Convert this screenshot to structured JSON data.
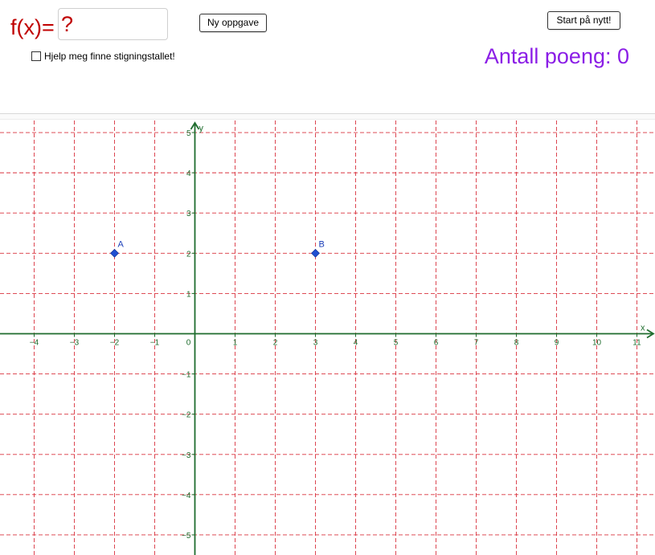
{
  "header": {
    "function_label": "f(x)=",
    "function_input_value": "?",
    "new_task_button": "Ny oppgave",
    "restart_button": "Start på nytt!",
    "help_checkbox_label": "Hjelp meg finne stigningstallet!",
    "help_checked": false,
    "score_label": "Antall poeng: 0"
  },
  "colors": {
    "function_text": "#c00000",
    "score_text": "#8b1ee6",
    "grid": "#d9333f",
    "axis": "#1f6d2e",
    "point": "#1f4fd1"
  },
  "graph": {
    "x_axis_label": "x",
    "y_axis_label": "y",
    "x_range": [
      -4.85,
      11.45
    ],
    "y_range": [
      -5.5,
      5.3
    ],
    "x_ticks": [
      -4,
      -3,
      -2,
      -1,
      1,
      2,
      3,
      4,
      5,
      6,
      7,
      8,
      9,
      10,
      11
    ],
    "y_ticks": [
      -5,
      -4,
      -3,
      -2,
      -1,
      1,
      2,
      3,
      4,
      5
    ],
    "origin_label": "0",
    "points": [
      {
        "name": "A",
        "x": -2,
        "y": 2
      },
      {
        "name": "B",
        "x": 3,
        "y": 2
      }
    ]
  }
}
